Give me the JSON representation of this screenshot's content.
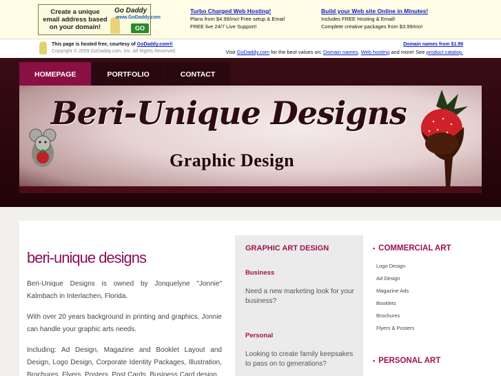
{
  "ad": {
    "banner_text": "Create a unique email address based on your domain!",
    "banner_logo": "Go Daddy",
    "banner_logo_url": "www.GoDaddy.com",
    "banner_go": "GO",
    "col1_title": "Turbo Charged Web Hosting!",
    "col1_line1": "Plans from $4.99/mo! Free setup & Email",
    "col1_line2": "FREE live 24/7 Live Support!",
    "col2_title": "Build your Web site Online in Minutes!",
    "col2_line1": "Includes FREE Hosting & Email!",
    "col2_line2": "Complete creative packages from $3.99/mo!",
    "hosted_text": "This page is hosted free, courtesy of",
    "hosted_link": "GoDaddy.com®",
    "copyright": "Copyright © 2009 GoDaddy.com, Inc. All Rights Reserved.",
    "domain_link": "Domain names from $1.99",
    "visit_prefix": "Visit",
    "visit_godaddy": "GoDaddy.com",
    "visit_mid": "for the best values on:",
    "visit_domains": "Domain names",
    "visit_hosting": "Web hosting",
    "visit_more": "and more! See",
    "visit_catalog": "product catalog."
  },
  "nav": {
    "items": [
      "HOMEPAGE",
      "PORTFOLIO",
      "CONTACT"
    ],
    "active": "HOMEPAGE"
  },
  "banner": {
    "title": "Beri-Unique Designs",
    "subtitle": "Graphic Design"
  },
  "main": {
    "title": "beri-unique designs",
    "p1": "Beri-Unique Designs is owned by Jonquelyne \"Jonnie\" Kalmbach in Interlachen, Florida.",
    "p2": "With over 20 years background in printing and graphics, Jonnie can handle your graphic arts needs.",
    "p3": "Including: Ad Design, Magazine and Booklet Layout and Design, Logo Design, Corporate Identity Packages, Illustration, Brochures, Flyers, Posters, Post Cards, Business Card design"
  },
  "middle": {
    "heading": "GRAPHIC ART DESIGN",
    "business_title": "Business",
    "business_text": "Need a new marketing look for your business?",
    "personal_title": "Personal",
    "personal_text": "Looking to create family keepsakes to pass on to generations?"
  },
  "right": {
    "commercial_heading": "COMMERCIAL ART",
    "commercial_items": [
      "Logo Design",
      "Ad Design",
      "Magazine Ads",
      "Booklets",
      "Brochures",
      "Flyers & Posters"
    ],
    "personal_heading": "PERSONAL ART",
    "bullet": "•"
  },
  "colors": {
    "accent": "#a0114e",
    "nav_active": "#8a0f42",
    "header_bg": "#2a0810",
    "link": "#1020c0"
  }
}
